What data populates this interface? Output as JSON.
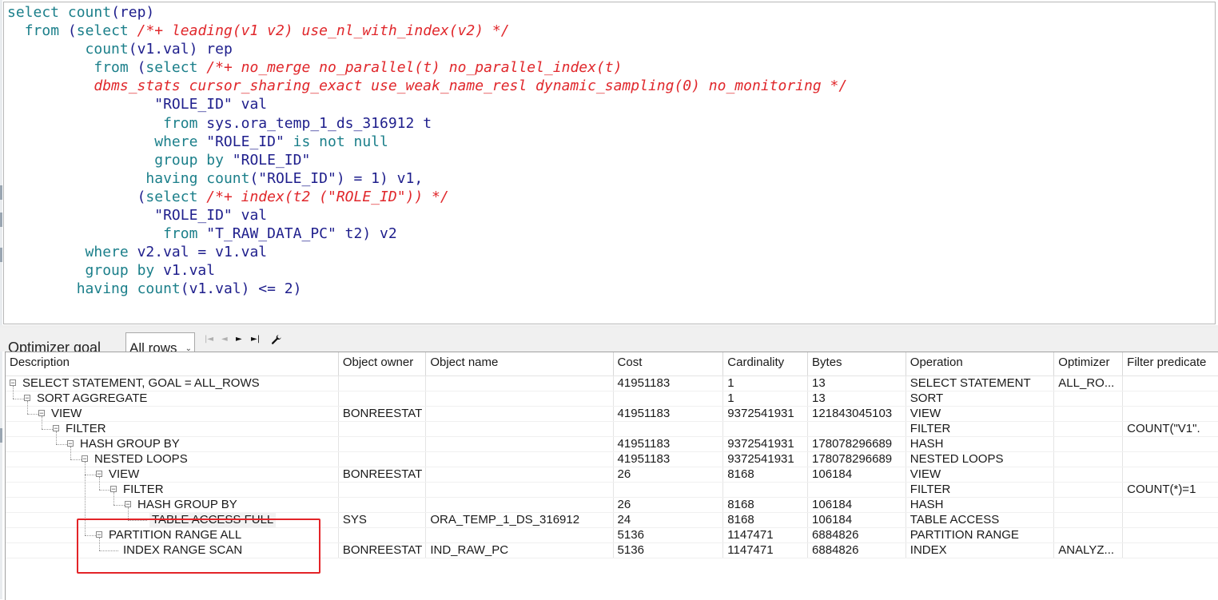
{
  "editor": {
    "sql_lines": [
      {
        "indent": 0,
        "tokens": [
          [
            "kw",
            "select"
          ],
          [
            "tx",
            " "
          ],
          [
            "kw",
            "count"
          ],
          [
            "tx",
            "(rep)"
          ]
        ]
      },
      {
        "indent": 2,
        "tokens": [
          [
            "kw",
            "from"
          ],
          [
            "tx",
            " ("
          ],
          [
            "kw",
            "select"
          ],
          [
            "tx",
            " "
          ],
          [
            "cm",
            "/*+ leading(v1 v2) use_nl_with_index(v2) */"
          ]
        ]
      },
      {
        "indent": 9,
        "tokens": [
          [
            "kw",
            "count"
          ],
          [
            "tx",
            "(v1.val) rep"
          ]
        ]
      },
      {
        "indent": 10,
        "tokens": [
          [
            "kw",
            "from"
          ],
          [
            "tx",
            " ("
          ],
          [
            "kw",
            "select"
          ],
          [
            "tx",
            " "
          ],
          [
            "cm",
            "/*+ no_merge no_parallel(t) no_parallel_index(t)"
          ]
        ]
      },
      {
        "indent": 10,
        "tokens": [
          [
            "cm",
            "dbms_stats cursor_sharing_exact use_weak_name_resl dynamic_sampling(0) no_monitoring */"
          ]
        ]
      },
      {
        "indent": 17,
        "tokens": [
          [
            "tx",
            "\"ROLE_ID\" val"
          ]
        ]
      },
      {
        "indent": 18,
        "tokens": [
          [
            "kw",
            "from"
          ],
          [
            "tx",
            " sys.ora_temp_1_ds_316912 t"
          ]
        ]
      },
      {
        "indent": 17,
        "tokens": [
          [
            "kw",
            "where"
          ],
          [
            "tx",
            " \"ROLE_ID\" "
          ],
          [
            "kw",
            "is not null"
          ]
        ]
      },
      {
        "indent": 17,
        "tokens": [
          [
            "kw",
            "group by"
          ],
          [
            "tx",
            " \"ROLE_ID\""
          ]
        ]
      },
      {
        "indent": 16,
        "tokens": [
          [
            "kw",
            "having"
          ],
          [
            "tx",
            " "
          ],
          [
            "kw",
            "count"
          ],
          [
            "tx",
            "(\"ROLE_ID\") = 1) v1,"
          ]
        ]
      },
      {
        "indent": 15,
        "tokens": [
          [
            "tx",
            "("
          ],
          [
            "kw",
            "select"
          ],
          [
            "tx",
            " "
          ],
          [
            "cm",
            "/*+ index(t2 (\"ROLE_ID\")) */"
          ]
        ]
      },
      {
        "indent": 17,
        "tokens": [
          [
            "tx",
            "\"ROLE_ID\" val"
          ]
        ]
      },
      {
        "indent": 18,
        "tokens": [
          [
            "kw",
            "from"
          ],
          [
            "tx",
            " \"T_RAW_DATA_PC\" t2) v2"
          ]
        ]
      },
      {
        "indent": 9,
        "tokens": [
          [
            "kw",
            "where"
          ],
          [
            "tx",
            " v2.val = v1.val"
          ]
        ]
      },
      {
        "indent": 9,
        "tokens": [
          [
            "kw",
            "group by"
          ],
          [
            "tx",
            " v1.val"
          ]
        ]
      },
      {
        "indent": 8,
        "tokens": [
          [
            "kw",
            "having"
          ],
          [
            "tx",
            " "
          ],
          [
            "kw",
            "count"
          ],
          [
            "tx",
            "(v1.val) <= 2)"
          ]
        ]
      }
    ]
  },
  "toolbar": {
    "optimizer_goal_label": "Optimizer goal",
    "optimizer_goal_value": "All rows",
    "dropdown_arrow": "⌄",
    "nav": {
      "first": "|◄",
      "prev": "◄",
      "next": "►",
      "last": "►|",
      "settings_icon": "wrench-icon"
    }
  },
  "plan": {
    "columns": [
      "Description",
      "Object owner",
      "Object name",
      "Cost",
      "Cardinality",
      "Bytes",
      "Operation",
      "Optimizer",
      "Filter predicate"
    ],
    "rows": [
      {
        "level": 0,
        "toggle": "⊟",
        "desc": "SELECT STATEMENT, GOAL = ALL_ROWS",
        "owner": "",
        "name": "",
        "cost": "41951183",
        "card": "1",
        "bytes": "13",
        "op": "SELECT STATEMENT",
        "opt": "ALL_RO...",
        "filter": ""
      },
      {
        "level": 1,
        "toggle": "⊟",
        "desc": "SORT AGGREGATE",
        "owner": "",
        "name": "",
        "cost": "",
        "card": "1",
        "bytes": "13",
        "op": "SORT",
        "opt": "",
        "filter": ""
      },
      {
        "level": 2,
        "toggle": "⊟",
        "desc": "VIEW",
        "owner": "BONREESTAT",
        "name": "",
        "cost": "41951183",
        "card": "9372541931",
        "bytes": "121843045103",
        "op": "VIEW",
        "opt": "",
        "filter": ""
      },
      {
        "level": 3,
        "toggle": "⊟",
        "desc": "FILTER",
        "owner": "",
        "name": "",
        "cost": "",
        "card": "",
        "bytes": "",
        "op": "FILTER",
        "opt": "",
        "filter": "COUNT(\"V1\"."
      },
      {
        "level": 4,
        "toggle": "⊟",
        "desc": "HASH GROUP BY",
        "owner": "",
        "name": "",
        "cost": "41951183",
        "card": "9372541931",
        "bytes": "178078296689",
        "op": "HASH",
        "opt": "",
        "filter": ""
      },
      {
        "level": 5,
        "toggle": "⊟",
        "desc": "NESTED LOOPS",
        "owner": "",
        "name": "",
        "cost": "41951183",
        "card": "9372541931",
        "bytes": "178078296689",
        "op": "NESTED LOOPS",
        "opt": "",
        "filter": ""
      },
      {
        "level": 6,
        "toggle": "⊟",
        "desc": "VIEW",
        "owner": "BONREESTAT",
        "name": "",
        "cost": "26",
        "card": "8168",
        "bytes": "106184",
        "op": "VIEW",
        "opt": "",
        "filter": ""
      },
      {
        "level": 7,
        "toggle": "⊟",
        "desc": "FILTER",
        "owner": "",
        "name": "",
        "cost": "",
        "card": "",
        "bytes": "",
        "op": "FILTER",
        "opt": "",
        "filter": "COUNT(*)=1"
      },
      {
        "level": 8,
        "toggle": "⊟",
        "desc": "HASH GROUP BY",
        "owner": "",
        "name": "",
        "cost": "26",
        "card": "8168",
        "bytes": "106184",
        "op": "HASH",
        "opt": "",
        "filter": ""
      },
      {
        "level": 9,
        "toggle": "",
        "desc": "TABLE ACCESS FULL",
        "owner": "SYS",
        "name": "ORA_TEMP_1_DS_316912",
        "cost": "24",
        "card": "8168",
        "bytes": "106184",
        "op": "TABLE ACCESS",
        "opt": "",
        "filter": "",
        "selected": true
      },
      {
        "level": 6,
        "toggle": "⊟",
        "desc": "PARTITION RANGE ALL",
        "owner": "",
        "name": "",
        "cost": "5136",
        "card": "1147471",
        "bytes": "6884826",
        "op": "PARTITION RANGE",
        "opt": "",
        "filter": ""
      },
      {
        "level": 7,
        "toggle": "",
        "desc": "INDEX RANGE SCAN",
        "owner": "BONREESTAT",
        "name": "IND_RAW_PC",
        "cost": "5136",
        "card": "1147471",
        "bytes": "6884826",
        "op": "INDEX",
        "opt": "ANALYZ...",
        "filter": ""
      }
    ]
  },
  "colors": {
    "keyword": "#1b7f8a",
    "comment": "#e0272b",
    "text": "#1e1e8c",
    "highlight_box": "#e32428"
  }
}
